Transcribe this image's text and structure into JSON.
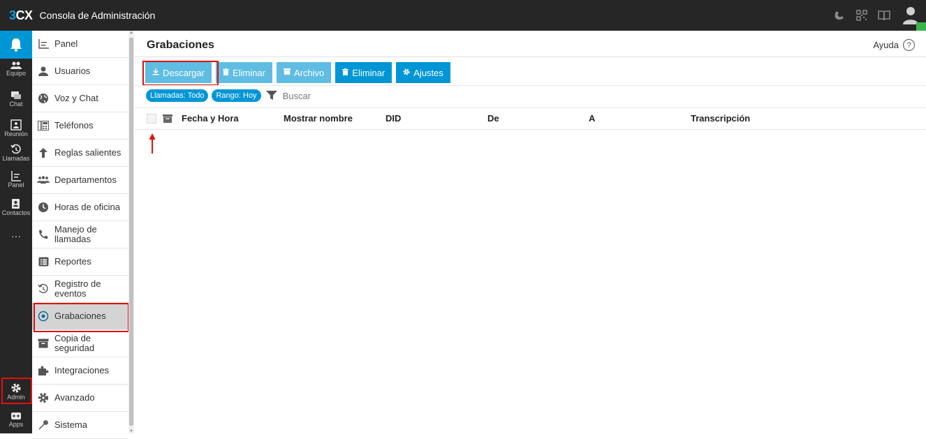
{
  "topbar": {
    "logo_prefix": "3",
    "logo_suffix": "CX",
    "title": "Consola de Administración"
  },
  "rail": {
    "items": [
      {
        "label": "Equipo",
        "icon": "team-icon"
      },
      {
        "label": "Chat",
        "icon": "chat-icon"
      },
      {
        "label": "Reunión",
        "icon": "meeting-icon"
      },
      {
        "label": "Llamadas",
        "icon": "call-history-icon"
      },
      {
        "label": "Panel",
        "icon": "panel-icon"
      },
      {
        "label": "Contactos",
        "icon": "contacts-icon"
      },
      {
        "label": "Admin",
        "icon": "gear-icon"
      },
      {
        "label": "Apps",
        "icon": "apps-icon"
      }
    ],
    "more": "···"
  },
  "nav": {
    "items": [
      {
        "label": "Panel",
        "icon": "panel-icon"
      },
      {
        "label": "Usuarios",
        "icon": "user-icon"
      },
      {
        "label": "Voz y Chat",
        "icon": "globe-icon"
      },
      {
        "label": "Teléfonos",
        "icon": "phone-grid-icon"
      },
      {
        "label": "Reglas salientes",
        "icon": "arrow-up-icon"
      },
      {
        "label": "Departamentos",
        "icon": "departments-icon"
      },
      {
        "label": "Horas de oficina",
        "icon": "clock-icon"
      },
      {
        "label": "Manejo de llamadas",
        "icon": "handset-icon"
      },
      {
        "label": "Reportes",
        "icon": "list-icon"
      },
      {
        "label": "Registro de eventos",
        "icon": "history-icon"
      },
      {
        "label": "Grabaciones",
        "icon": "record-icon"
      },
      {
        "label": "Copia de seguridad",
        "icon": "archive-icon"
      },
      {
        "label": "Integraciones",
        "icon": "puzzle-icon"
      },
      {
        "label": "Avanzado",
        "icon": "gear-icon"
      },
      {
        "label": "Sistema",
        "icon": "wrench-icon"
      }
    ],
    "active": "Grabaciones"
  },
  "main": {
    "title": "Grabaciones",
    "help": "Ayuda",
    "toolbar": {
      "descargar": "Descargar",
      "eliminar1": "Eliminar",
      "archivo": "Archivo",
      "eliminar2": "Eliminar",
      "ajustes": "Ajustes"
    },
    "filters": {
      "llamadas": "Llamadas: Todo",
      "rango": "Rango: Hoy",
      "search_placeholder": "Buscar"
    },
    "columns": [
      "Fecha y Hora",
      "Mostrar nombre",
      "DID",
      "De",
      "A",
      "Transcripción"
    ]
  },
  "colors": {
    "accent": "#0096d6",
    "accent_light": "#5fbde3",
    "dark": "#262626",
    "highlight": "#e01010",
    "online": "#39b54a"
  }
}
